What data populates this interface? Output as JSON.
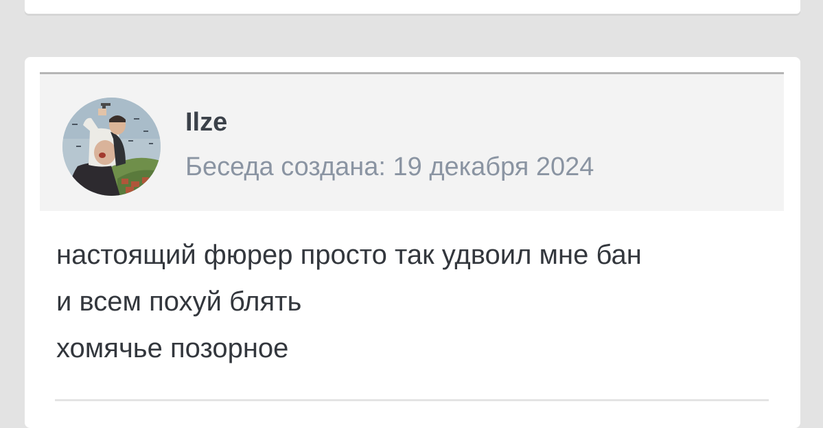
{
  "post": {
    "author": "Ilze",
    "created_label": "Беседа создана: 19 декабря 2024",
    "avatar_icon": "user-avatar-painting",
    "message_lines": [
      "настоящий фюрер просто так удвоил мне бан",
      "и всем похуй блять",
      "хомячье позорное"
    ]
  },
  "colors": {
    "page_background": "#e3e3e3",
    "card_background": "#ffffff",
    "header_background": "#f3f3f3",
    "author_text": "#3b4149",
    "meta_text": "#8a94a2",
    "message_text": "#33373d"
  }
}
